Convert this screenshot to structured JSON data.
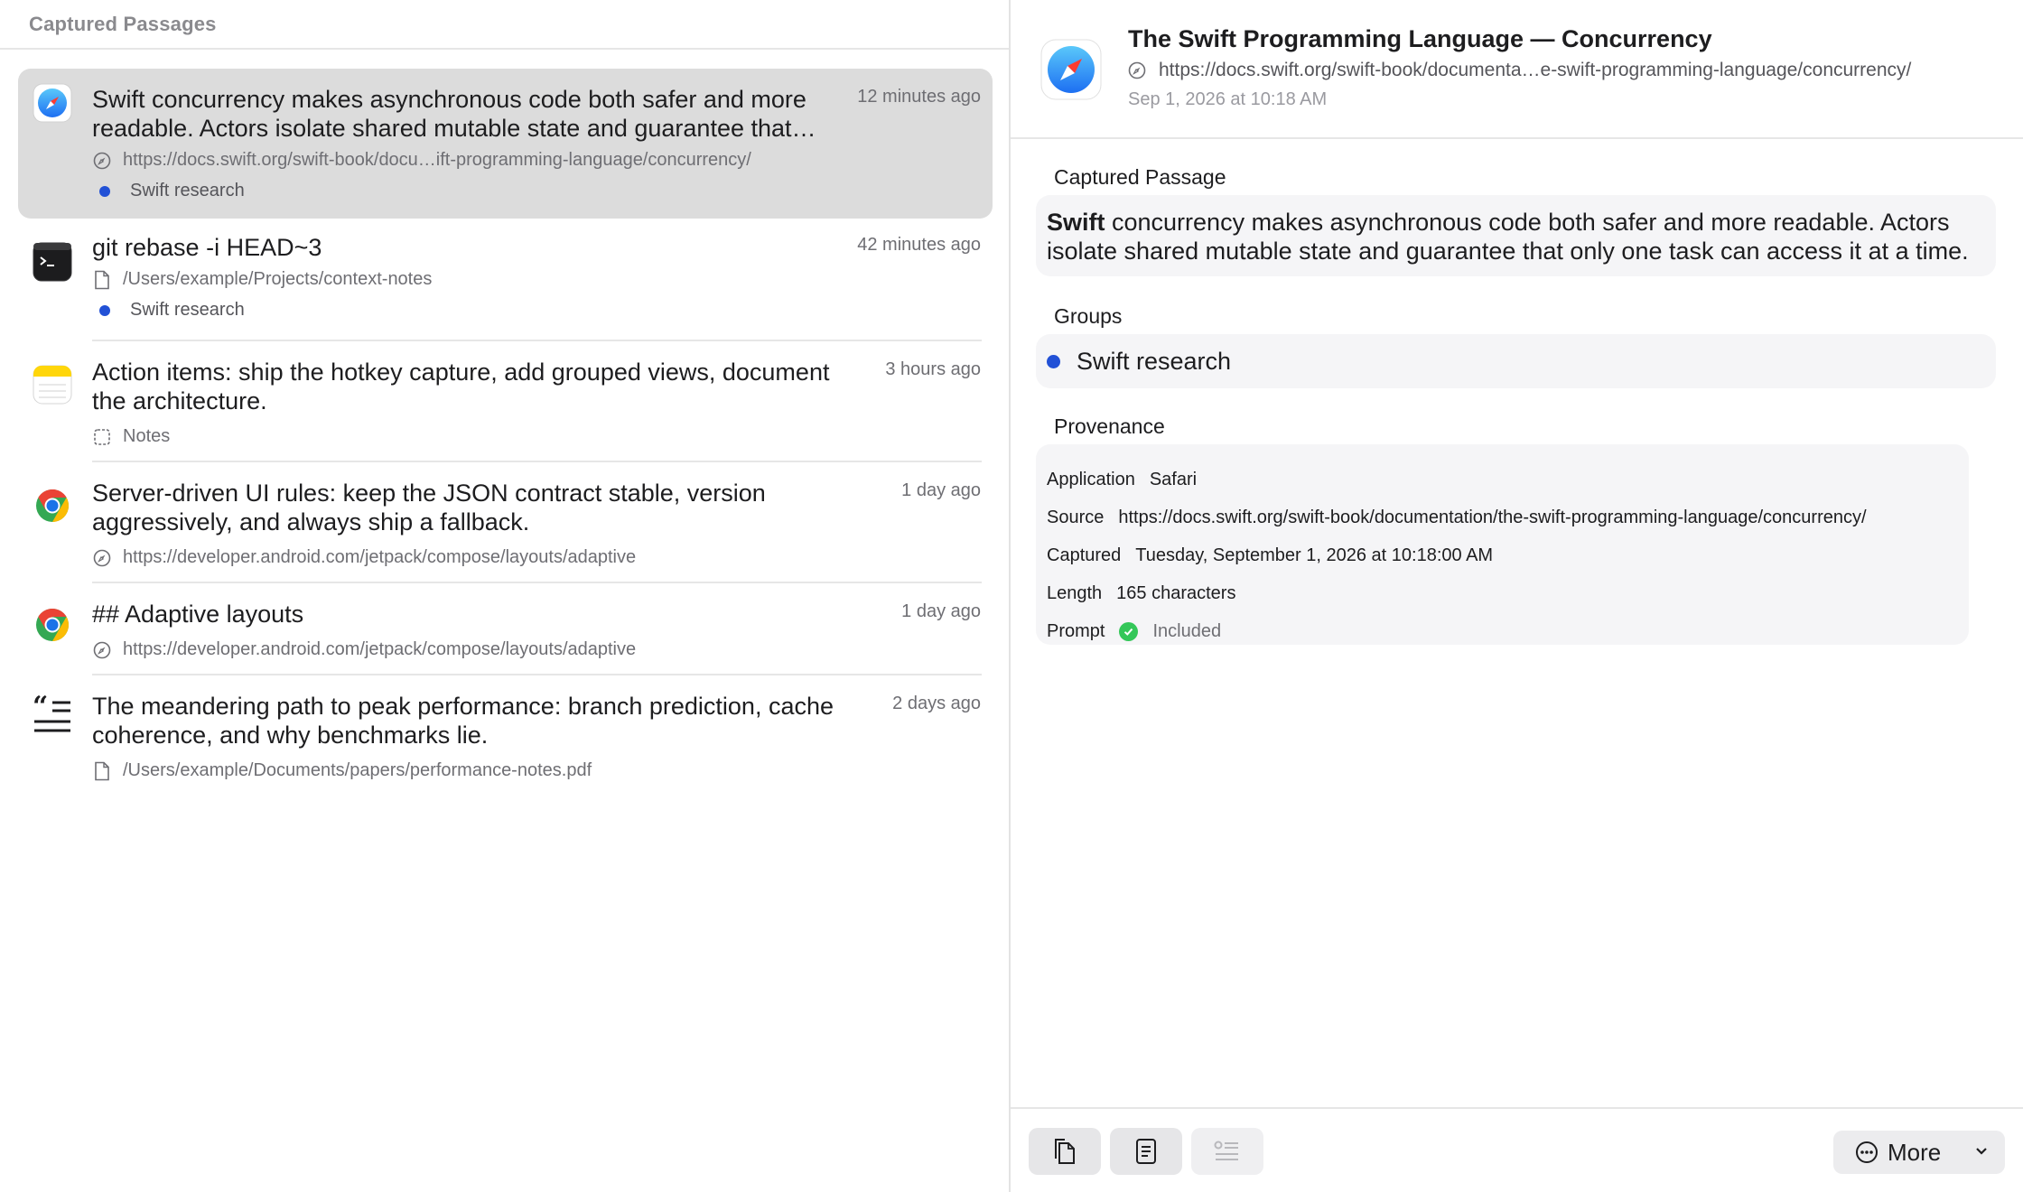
{
  "list": {
    "header": "Captured Passages",
    "items": [
      {
        "app": "Safari",
        "icon": "safari-icon",
        "title": "Swift concurrency makes asynchronous code both safer and more readable. Actors isolate shared mutable state and guarantee that…",
        "time": "12 minutes ago",
        "meta": "https://docs.swift.org/swift-book/docu…ift-programming-language/concurrency/",
        "meta_icon": "compass-icon",
        "group": "Swift research",
        "selected": true
      },
      {
        "app": "Terminal",
        "icon": "terminal-icon",
        "title": "git rebase -i HEAD~3",
        "time": "42 minutes ago",
        "meta": "/Users/example/Projects/context-notes",
        "meta_icon": "document-icon",
        "group": "Swift research"
      },
      {
        "app": "Notes",
        "icon": "notes-icon",
        "title": "Action items: ship the hotkey capture, add grouped views, document the architecture.",
        "time": "3 hours ago",
        "meta": "Notes",
        "meta_icon": "window-icon"
      },
      {
        "app": "Chrome",
        "icon": "chrome-icon",
        "title": "Server-driven UI rules: keep the JSON contract stable, version aggressively, and always ship a fallback.",
        "time": "1 day ago",
        "meta": "https://developer.android.com/jetpack/compose/layouts/adaptive",
        "meta_icon": "compass-icon"
      },
      {
        "app": "Chrome",
        "icon": "chrome-icon",
        "title": "## Adaptive layouts",
        "time": "1 day ago",
        "meta": "https://developer.android.com/jetpack/compose/layouts/adaptive",
        "meta_icon": "compass-icon"
      },
      {
        "app": "Quote",
        "icon": "quote-icon",
        "title": "The meandering path to peak performance: branch prediction, cache coherence, and why benchmarks lie.",
        "time": "2 days ago",
        "meta": "/Users/example/Documents/papers/performance-notes.pdf",
        "meta_icon": "document-icon"
      }
    ]
  },
  "detail": {
    "title": "The Swift Programming Language — Concurrency",
    "url": "https://docs.swift.org/swift-book/documenta…e-swift-programming-language/concurrency/",
    "date": "Sep 1, 2026 at 10:18 AM",
    "passage_label": "Captured Passage",
    "passage_bold": "Swift",
    "passage_rest": " concurrency makes asynchronous code both safer and more readable. Actors isolate shared mutable state and guarantee that only one task can access it at a time.",
    "groups_label": "Groups",
    "group": "Swift research",
    "provenance_label": "Provenance",
    "provenance": {
      "application_key": "Application",
      "application": "Safari",
      "source_key": "Source",
      "source": "https://docs.swift.org/swift-book/documentation/the-swift-programming-language/concurrency/",
      "captured_key": "Captured",
      "captured": "Tuesday, September 1, 2026 at 10:18:00 AM",
      "length_key": "Length",
      "length": "165 characters",
      "prompt_key": "Prompt",
      "prompt": "Included"
    }
  },
  "toolbar": {
    "more_label": "More"
  },
  "colors": {
    "group_dot": "#2251d6",
    "selected_row": "#dcdcdc",
    "included_check": "#34c759"
  }
}
